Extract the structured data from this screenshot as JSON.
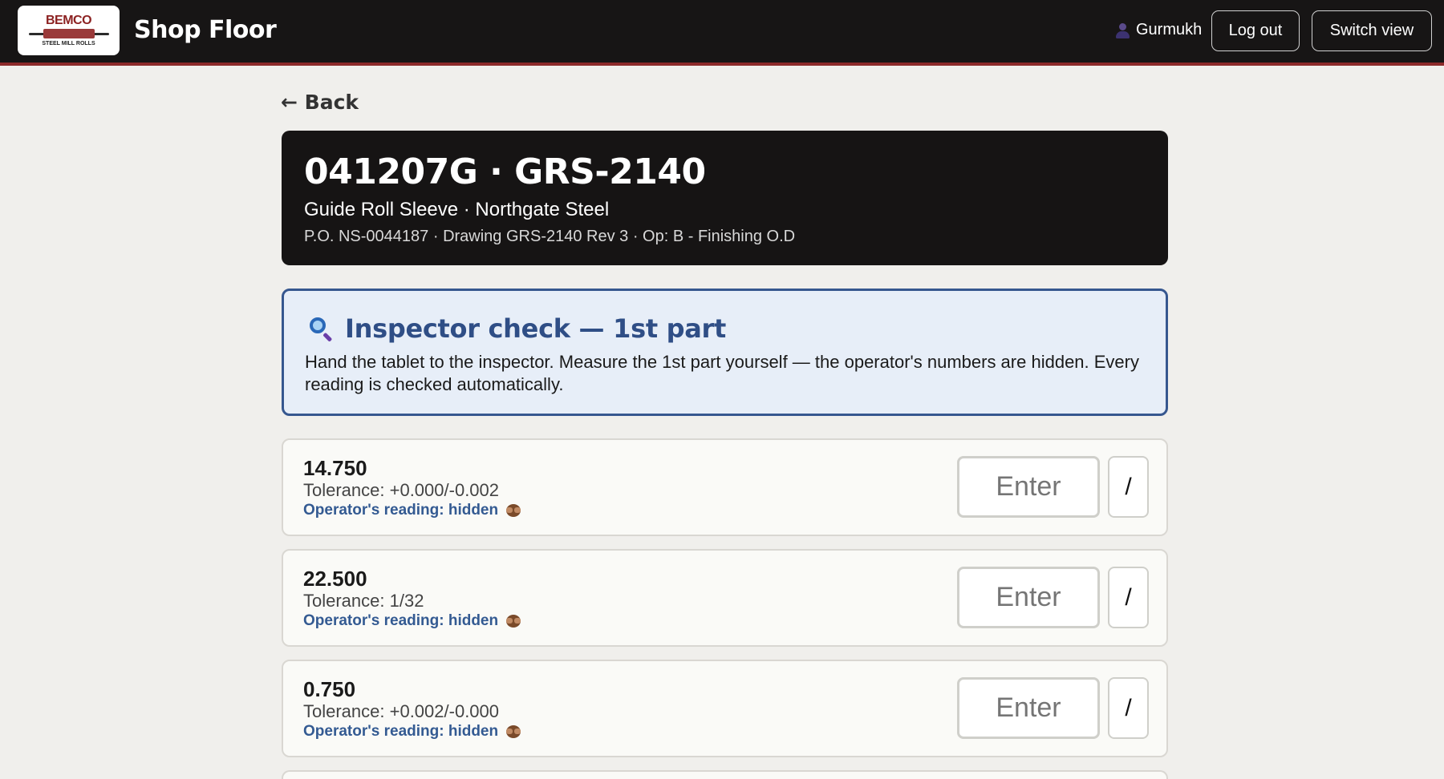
{
  "header": {
    "logo": {
      "top_text": "BEMCO",
      "bottom_text": "STEEL MILL ROLLS"
    },
    "title": "Shop Floor",
    "user_icon": "user-icon",
    "user_name": "Gurmukh",
    "logout_label": "Log out",
    "switch_label": "Switch view",
    "colors": {
      "bar_bg": "#171515",
      "accent": "#8c2a2a"
    }
  },
  "nav": {
    "back_label": "← Back"
  },
  "job": {
    "title": "041207G · GRS-2140",
    "subtitle": "Guide Roll Sleeve · Northgate Steel",
    "meta": "P.O. NS-0044187 · Drawing GRS-2140 Rev 3 · Op: B - Finishing O.D"
  },
  "inspection": {
    "icon": "magnifier-icon",
    "title": "Inspector check — 1st part",
    "text": "Hand the tablet to the inspector. Measure the 1st part yourself — the operator's numbers are hidden. Every reading is checked automatically.",
    "colors": {
      "border": "#36578f",
      "bg": "#e7eef8"
    }
  },
  "dimensions": [
    {
      "value": "14.750",
      "tolerance": "Tolerance: +0.000/-0.002",
      "operator": "Operator's reading: hidden",
      "placeholder": "Enter",
      "slash": "/"
    },
    {
      "value": "22.500",
      "tolerance": "Tolerance: 1/32",
      "operator": "Operator's reading: hidden",
      "placeholder": "Enter",
      "slash": "/"
    },
    {
      "value": "0.750",
      "tolerance": "Tolerance: +0.002/-0.000",
      "operator": "Operator's reading: hidden",
      "placeholder": "Enter",
      "slash": "/"
    }
  ]
}
